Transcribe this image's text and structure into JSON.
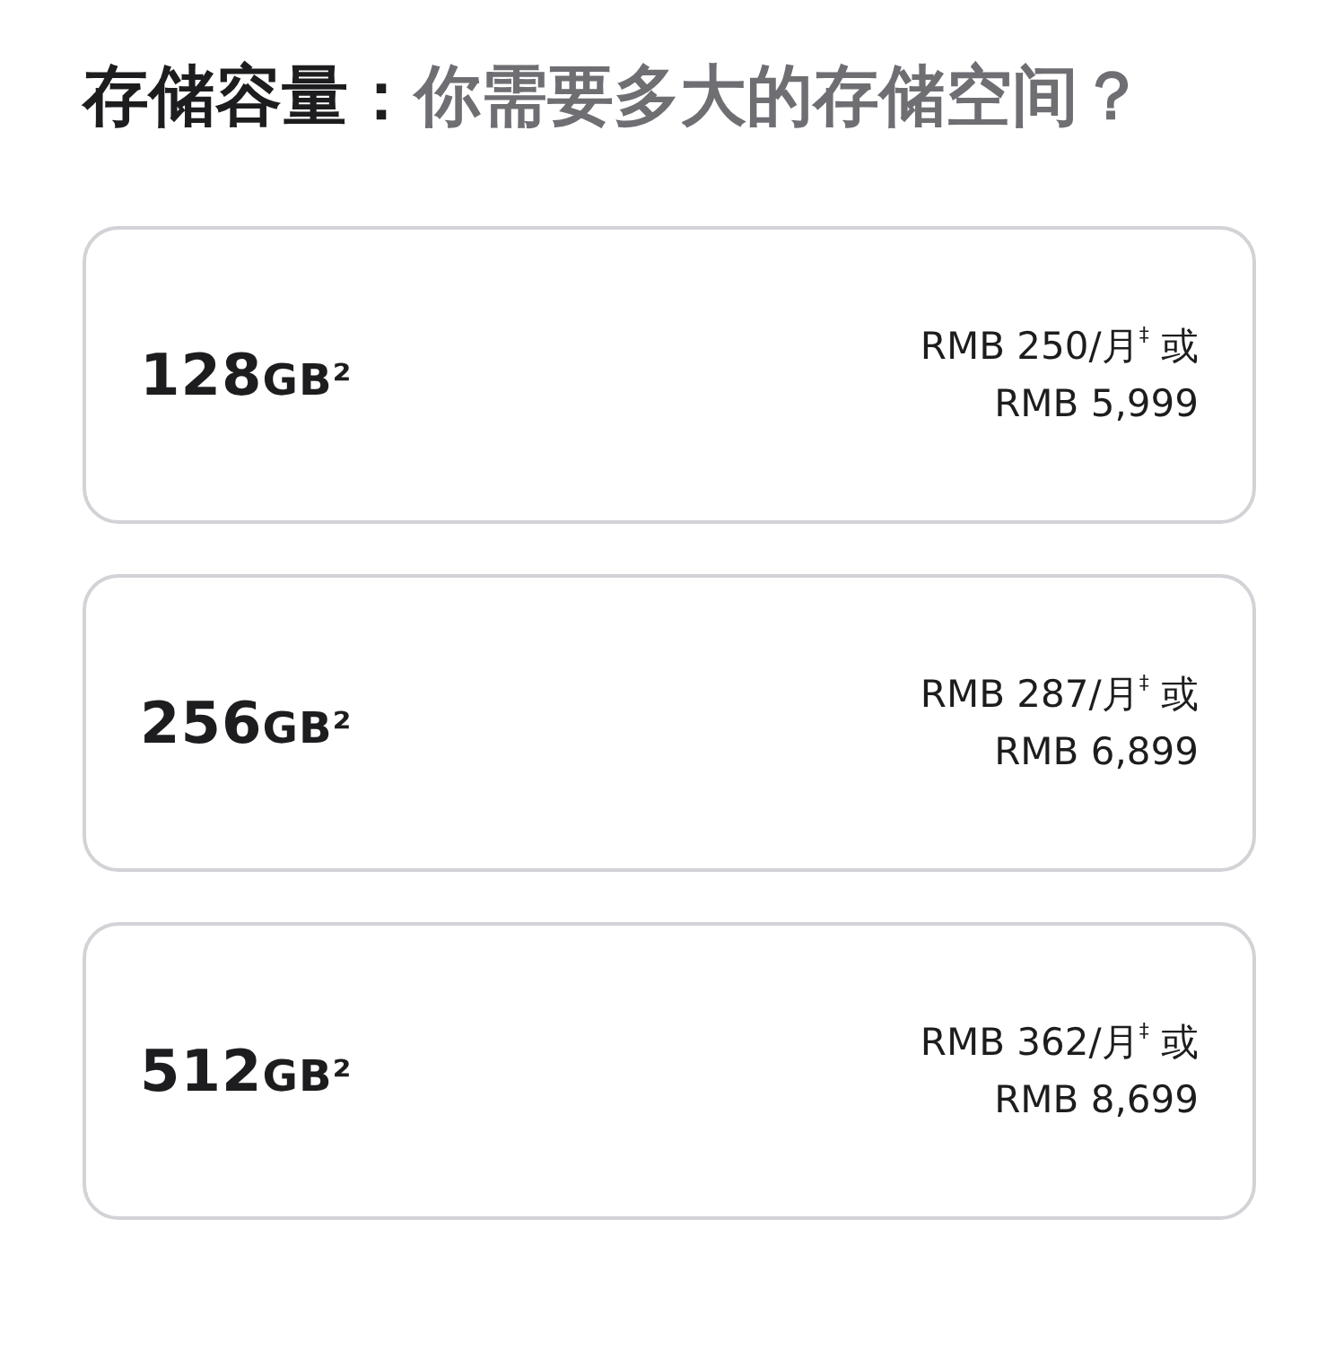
{
  "heading": {
    "lead": "存储容量：",
    "rest": "你需要多大的存储空间？"
  },
  "options": [
    {
      "capacity": "128",
      "unit": "GB²",
      "monthly": "RMB 250/月$^{‡}$ 或",
      "price": "RMB 5,999"
    },
    {
      "capacity": "256",
      "unit": "GB²",
      "monthly": "RMB 287/月$^{‡}$ 或",
      "price": "RMB 6,899"
    },
    {
      "capacity": "512",
      "unit": "GB²",
      "monthly": "RMB 362/月$^{‡}$ 或",
      "price": "RMB 8,699"
    }
  ]
}
